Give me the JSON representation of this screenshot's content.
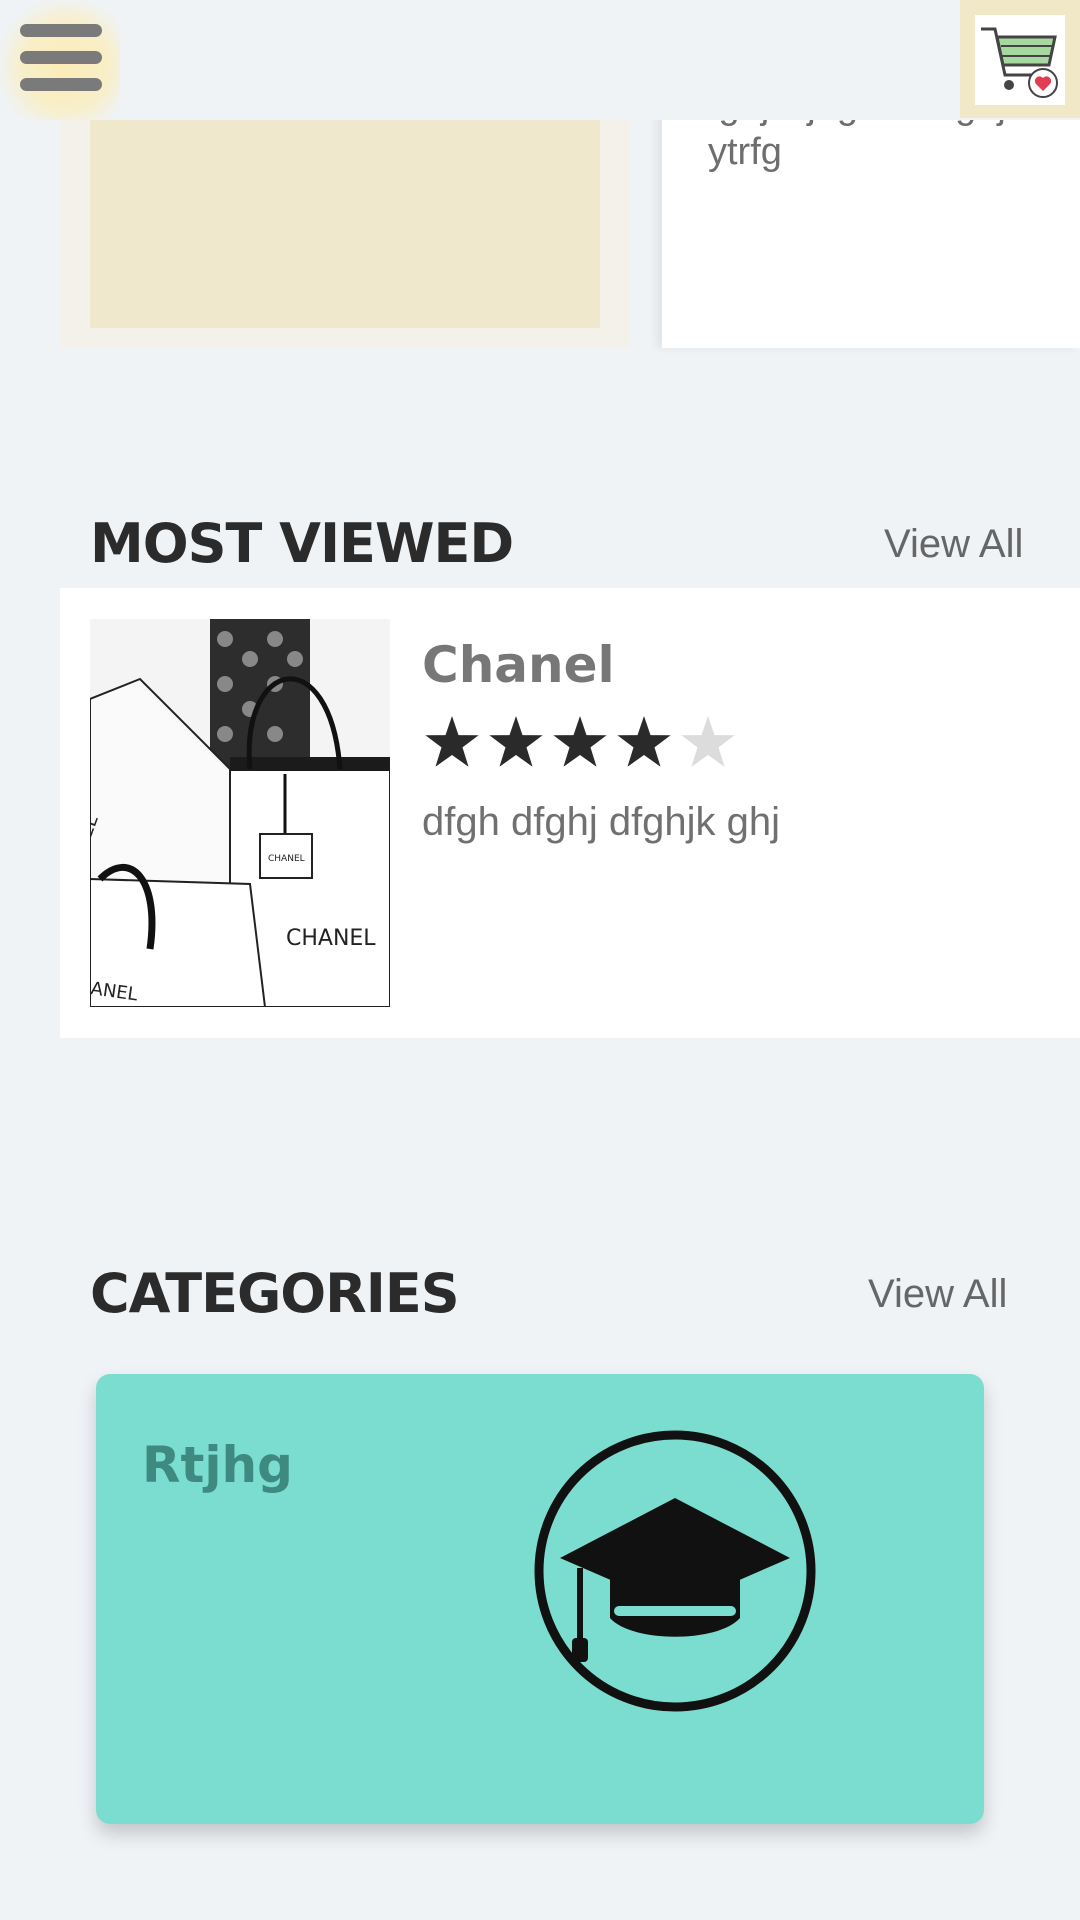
{
  "header": {
    "menu_icon": "hamburger-menu-icon",
    "cart_icon": "shopping-cart-heart-icon"
  },
  "featured": {
    "right_card_text_line1": "fghjkkjhgfddertghju",
    "right_card_text_line2": "ytrfg"
  },
  "most_viewed": {
    "title": "MOST VIEWED",
    "view_all_label": "View All",
    "items": [
      {
        "name": "Chanel",
        "rating": 4,
        "rating_max": 5,
        "description": "dfgh dfghj dfghjk ghj",
        "image_labels": [
          "CHANEL",
          "ANEL",
          "EL"
        ]
      }
    ]
  },
  "categories": {
    "title": "CATEGORIES",
    "view_all_label": "View All",
    "items": [
      {
        "name": "Rtjhg",
        "icon": "graduation-cap-icon",
        "color": "#7bddcf"
      }
    ]
  },
  "colors": {
    "background": "#eff3f6",
    "star_filled": "#2a2a2a",
    "star_empty": "#dcdcdc",
    "category_card": "#7bddcf"
  }
}
